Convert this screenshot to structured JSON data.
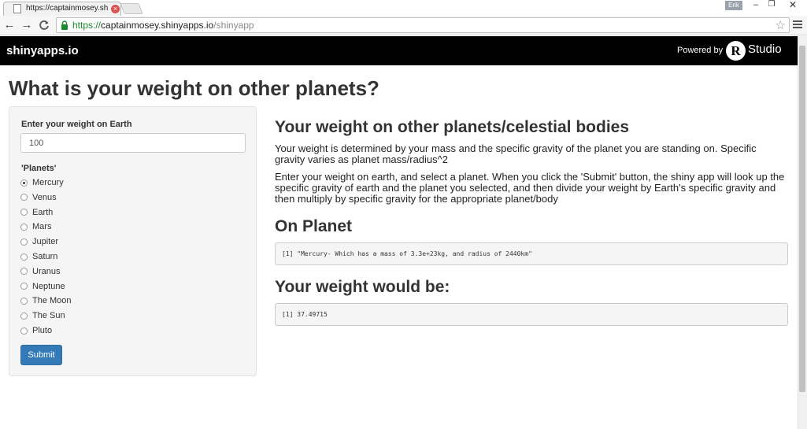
{
  "browser": {
    "tab_title": "https://captainmosey.shin",
    "tab_close": "×",
    "user_badge": "Erik",
    "url_scheme": "https://",
    "url_host": "captainmosey.shinyapps.io",
    "url_path": "/shinyapp",
    "back_glyph": "←",
    "forward_glyph": "→",
    "reload_glyph": "C",
    "star_glyph": "☆",
    "minimize_glyph": "–",
    "maximize_glyph": "❐",
    "close_glyph": "✕"
  },
  "navbar": {
    "brand": "shinyapps.io",
    "powered_by": "Powered by",
    "r_logo": "R",
    "rstudio": "Studio"
  },
  "page": {
    "title": "What is your weight on other planets?"
  },
  "sidebar": {
    "weight_label": "Enter your weight on Earth",
    "weight_value": "100",
    "planets_label": "'Planets'",
    "planets": [
      "Mercury",
      "Venus",
      "Earth",
      "Mars",
      "Jupiter",
      "Saturn",
      "Uranus",
      "Neptune",
      "The Moon",
      "The Sun",
      "Pluto"
    ],
    "selected_planet": "Mercury",
    "submit_label": "Submit"
  },
  "main": {
    "heading": "Your weight on other planets/celestial bodies",
    "paragraph1": "Your weight is determined by your mass and the specific gravity of the planet you are standing on. Specific gravity varies as planet mass/radius^2",
    "paragraph2": "Enter your weight on earth, and select a planet. When you click the 'Submit' button, the shiny app will look up the specific gravity of earth and the planet you selected, and then divide your weight by Earth's specific gravity and then multiply by specific gravity for the appropriate planet/body",
    "on_planet_heading": "On Planet",
    "on_planet_output": "[1] \"Mercury- Which has a mass of 3.3e+23kg, and radius of 2440km\"",
    "weight_heading": "Your weight would be:",
    "weight_output": "[1] 37.49715"
  },
  "colors": {
    "navbar_bg": "#000000",
    "submit_bg": "#337ab7",
    "url_https": "#1a8a2e"
  }
}
